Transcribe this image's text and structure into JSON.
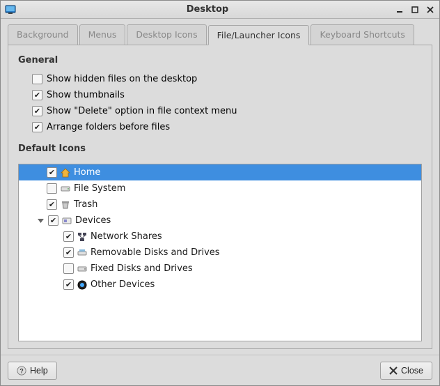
{
  "window": {
    "title": "Desktop"
  },
  "tabs": {
    "background": "Background",
    "menus": "Menus",
    "desktop_icons": "Desktop Icons",
    "file_launcher": "File/Launcher Icons",
    "keyboard": "Keyboard Shortcuts"
  },
  "sections": {
    "general": "General",
    "default_icons": "Default Icons"
  },
  "general_items": {
    "show_hidden": {
      "label": "Show hidden files on the desktop",
      "checked": false
    },
    "show_thumbnails": {
      "label": "Show thumbnails",
      "checked": true
    },
    "show_delete": {
      "label": "Show \"Delete\" option in file context menu",
      "checked": true
    },
    "arrange_folders": {
      "label": "Arrange folders before files",
      "checked": true
    }
  },
  "tree": {
    "home": {
      "label": "Home",
      "checked": true,
      "selected": true
    },
    "filesystem": {
      "label": "File System",
      "checked": false
    },
    "trash": {
      "label": "Trash",
      "checked": true
    },
    "devices": {
      "label": "Devices",
      "checked": true,
      "expanded": true
    },
    "network_shares": {
      "label": "Network Shares",
      "checked": true
    },
    "removable": {
      "label": "Removable Disks and Drives",
      "checked": true
    },
    "fixed": {
      "label": "Fixed Disks and Drives",
      "checked": false
    },
    "other_devices": {
      "label": "Other Devices",
      "checked": true
    }
  },
  "footer": {
    "help": "Help",
    "close": "Close"
  }
}
